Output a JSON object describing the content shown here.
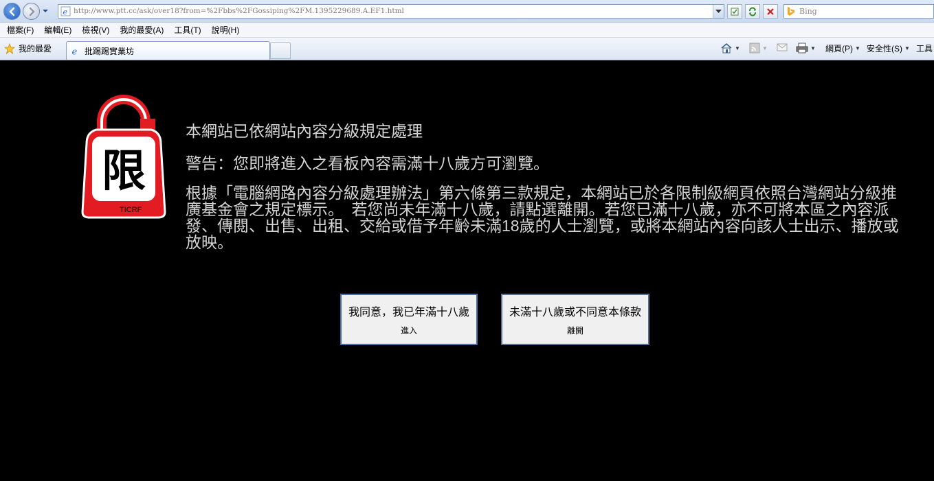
{
  "browser": {
    "url": "http://www.ptt.cc/ask/over18?from=%2Fbbs%2FGossiping%2FM.1395229689.A.EF1.html",
    "search_placeholder": "Bing",
    "menu": [
      "檔案(F)",
      "編輯(E)",
      "檢視(V)",
      "我的最愛(A)",
      "工具(T)",
      "說明(H)"
    ],
    "favorites_label": "我的最愛",
    "tab_title": "批踢踢實業坊",
    "commands": {
      "page": "網頁(P)",
      "safety": "安全性(S)",
      "tools": "工具"
    }
  },
  "page": {
    "logo_text": "TICRF",
    "logo_char": "限",
    "heading": "本網站已依網站內容分級規定處理",
    "warning": "警告：您即將進入之看板內容需滿十八歲方可瀏覽。",
    "body": "根據「電腦網路內容分級處理辦法」第六條第三款規定，本網站已於各限制級網頁依照台灣網站分級推廣基金會之規定標示。　若您尚未年滿十八歲，請點選離開。若您已滿十八歲，亦不可將本區之內容派發、傳閱、出售、出租、交給或借予年齡未滿18歲的人士瀏覽，或將本網站內容向該人士出示、播放或放映。",
    "agree_button": {
      "line1": "我同意，我已年滿十八歲",
      "line2": "進入"
    },
    "leave_button": {
      "line1": "未滿十八歲或不同意本條款",
      "line2": "離開"
    }
  },
  "colors": {
    "background": "#000000",
    "text": "#d4d4d4",
    "logo_red": "#e31b23"
  }
}
